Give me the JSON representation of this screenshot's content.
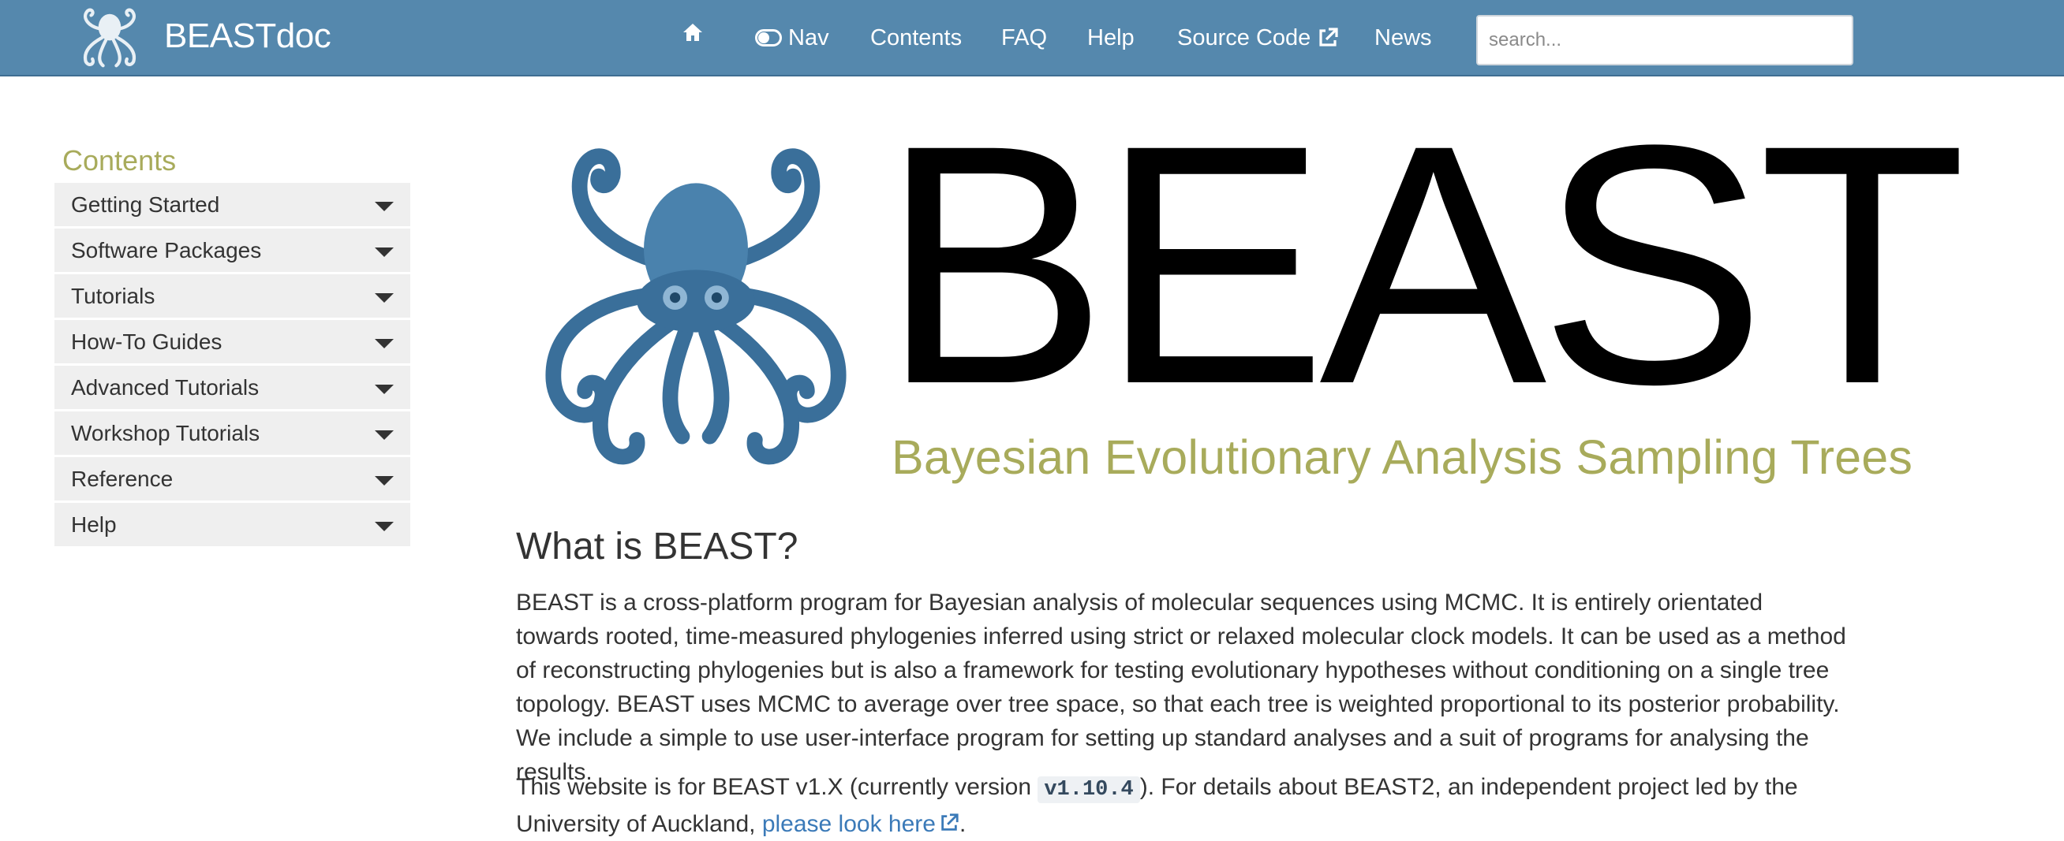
{
  "brand": {
    "name": "BEASTdoc",
    "logo_icon": "octopus-logo-icon"
  },
  "nav": {
    "items": [
      {
        "label": "",
        "icon": "home-icon"
      },
      {
        "label": "Nav",
        "icon": "toggle-icon"
      },
      {
        "label": "Contents"
      },
      {
        "label": "FAQ"
      },
      {
        "label": "Help"
      },
      {
        "label": "Source Code",
        "icon": "external-link-icon"
      },
      {
        "label": "News"
      }
    ],
    "search_placeholder": "search..."
  },
  "sidebar": {
    "title": "Contents",
    "items": [
      {
        "label": "Getting Started"
      },
      {
        "label": "Software Packages"
      },
      {
        "label": "Tutorials"
      },
      {
        "label": "How-To Guides"
      },
      {
        "label": "Advanced Tutorials"
      },
      {
        "label": "Workshop Tutorials"
      },
      {
        "label": "Reference"
      },
      {
        "label": "Help"
      }
    ]
  },
  "hero": {
    "title": "BEAST",
    "subtitle": "Bayesian Evolutionary Analysis Sampling Trees"
  },
  "main": {
    "heading": "What is BEAST?",
    "paragraph1": "BEAST is a cross-platform program for Bayesian analysis of molecular sequences using MCMC. It is entirely orientated towards rooted, time-measured phylogenies inferred using strict or relaxed molecular clock models. It can be used as a method of reconstructing phylogenies but is also a framework for testing evolutionary hypotheses without conditioning on a single tree topology. BEAST uses MCMC to average over tree space, so that each tree is weighted proportional to its posterior probability. We include a simple to use user-interface program for setting up standard analyses and a suit of programs for analysing the results.",
    "paragraph2_before": "This website is for BEAST v1.X (currently version ",
    "version": "v1.10.4",
    "paragraph2_after": "). For details about BEAST2, an independent project led by the University of Auckland, ",
    "link_text": "please look here",
    "paragraph2_end": "."
  },
  "colors": {
    "navbar": "#5588ad",
    "accent": "#a8ab5b",
    "link": "#3b7ab8"
  }
}
